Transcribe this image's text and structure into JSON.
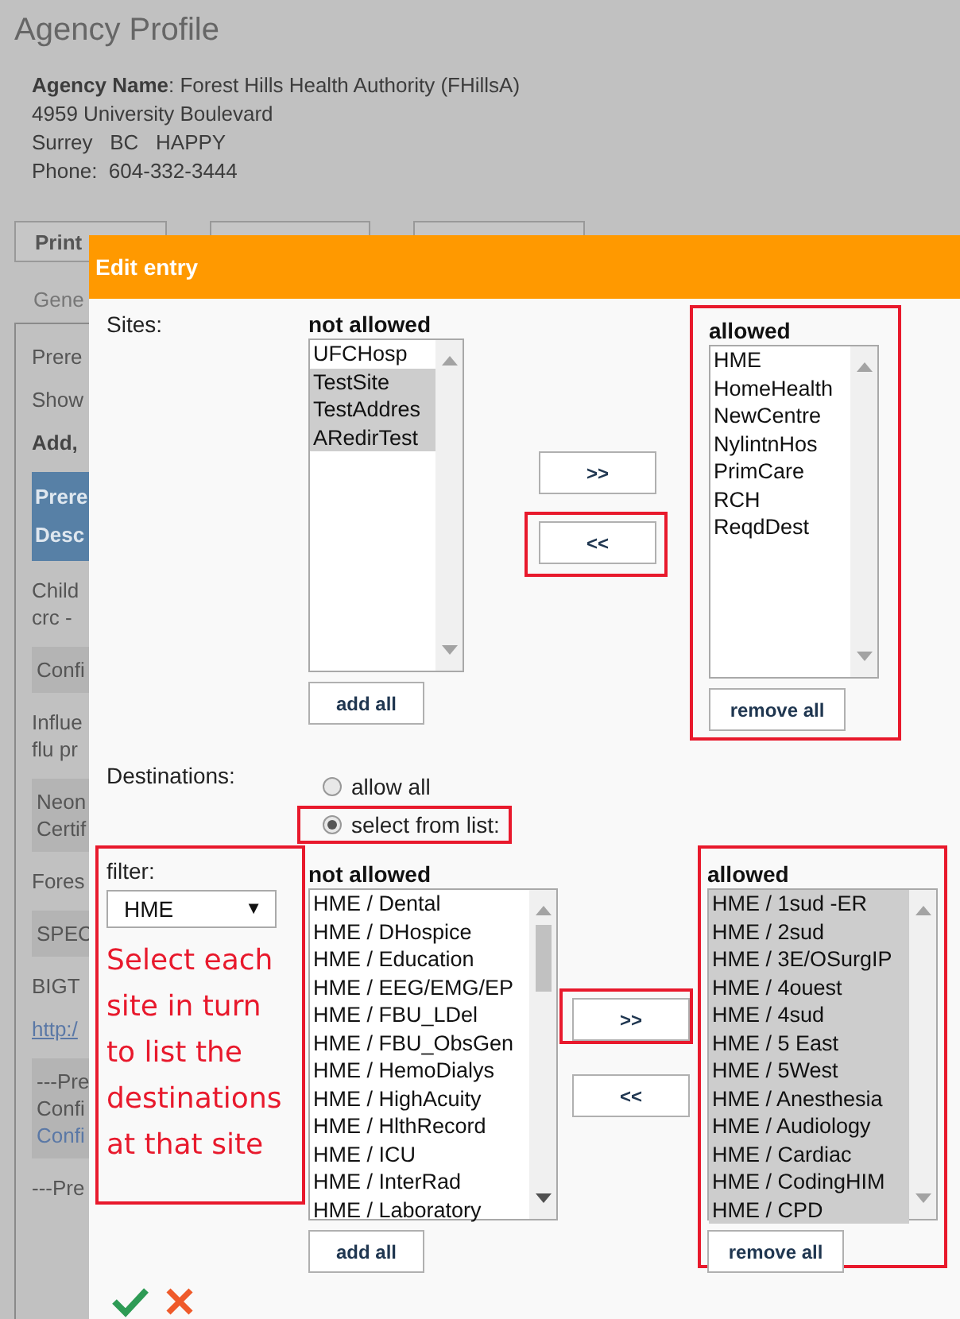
{
  "page": {
    "title": "Agency Profile",
    "info": [
      "**Agency Name**: Forest Hills Health Authority (FHillsA)",
      "4959 University Boulevard",
      "Surrey   BC   HAPPY",
      "Phone:  604-332-3444"
    ],
    "print_button": "Print",
    "tab": "Gene",
    "panel_rows": [
      {
        "kind": "text",
        "lines": [
          {
            "text": "Prere",
            "link": false
          }
        ]
      },
      {
        "kind": "text",
        "lines": [
          {
            "text": "Show",
            "link": false
          }
        ]
      },
      {
        "kind": "bold",
        "lines": [
          {
            "text": "Add,",
            "link": false
          }
        ]
      },
      {
        "kind": "header",
        "lines": [
          {
            "text": "Prere",
            "link": false
          },
          {
            "text": "Desc",
            "link": false
          }
        ]
      },
      {
        "kind": "text",
        "lines": [
          {
            "text": "Child",
            "link": false
          },
          {
            "text": "crc -",
            "link": false
          }
        ]
      },
      {
        "kind": "shaded",
        "lines": [
          {
            "text": "Confi",
            "link": false
          }
        ]
      },
      {
        "kind": "text",
        "lines": [
          {
            "text": "Influe",
            "link": false
          },
          {
            "text": "flu pr",
            "link": false
          }
        ]
      },
      {
        "kind": "shaded",
        "lines": [
          {
            "text": "Neon",
            "link": false
          },
          {
            "text": "Certif",
            "link": false
          }
        ]
      },
      {
        "kind": "text",
        "lines": [
          {
            "text": "Fores",
            "link": false
          }
        ]
      },
      {
        "kind": "shaded",
        "lines": [
          {
            "text": "SPEC",
            "link": false
          }
        ]
      },
      {
        "kind": "text",
        "lines": [
          {
            "text": "BIGT",
            "link": false
          }
        ]
      },
      {
        "kind": "text",
        "lines": [
          {
            "text": "http:/",
            "link": true
          }
        ]
      },
      {
        "kind": "shaded",
        "lines": [
          {
            "text": "---Pre",
            "link": false
          },
          {
            "text": "Confi",
            "link": false
          },
          {
            "text": "Confi",
            "link": true
          }
        ]
      },
      {
        "kind": "text",
        "lines": [
          {
            "text": "---Pre",
            "link": false
          }
        ]
      }
    ]
  },
  "dialog": {
    "title": "Edit entry",
    "sites": {
      "label": "Sites:",
      "not_allowed": {
        "heading": "not allowed",
        "highlighted": false,
        "button": "add all",
        "items": [
          {
            "text": "UFCHosp",
            "selected": false
          },
          {
            "text": "TestSite",
            "selected": true
          },
          {
            "text": "TestAddres",
            "selected": true
          },
          {
            "text": "ARedirTest",
            "selected": true
          }
        ]
      },
      "movers": [
        {
          "label": ">>",
          "highlighted": false
        },
        {
          "label": "<<",
          "highlighted": true
        }
      ],
      "allowed": {
        "heading": "allowed",
        "highlighted": true,
        "button": "remove all",
        "items": [
          {
            "text": "HME",
            "selected": false
          },
          {
            "text": "HomeHealth",
            "selected": false
          },
          {
            "text": "NewCentre",
            "selected": false
          },
          {
            "text": "NylintnHos",
            "selected": false
          },
          {
            "text": "PrimCare",
            "selected": false
          },
          {
            "text": "RCH",
            "selected": false
          },
          {
            "text": "ReqdDest",
            "selected": false
          }
        ]
      }
    },
    "destinations": {
      "label": "Destinations:",
      "options": [
        {
          "label": "allow all",
          "selected": false,
          "highlighted": false
        },
        {
          "label": "select from list:",
          "selected": true,
          "highlighted": true
        }
      ],
      "filter": {
        "label": "filter:",
        "value": "HME",
        "caret": "▼",
        "note": "Select each site in turn to list the destinations at that site",
        "highlighted": true
      },
      "not_allowed": {
        "heading": "not allowed",
        "highlighted": false,
        "button": "add all",
        "items": [
          {
            "text": "HME / Dental",
            "selected": false
          },
          {
            "text": "HME / DHospice",
            "selected": false
          },
          {
            "text": "HME / Education",
            "selected": false
          },
          {
            "text": "HME / EEG/EMG/EP",
            "selected": false
          },
          {
            "text": "HME / FBU_LDel",
            "selected": false
          },
          {
            "text": "HME / FBU_ObsGen",
            "selected": false
          },
          {
            "text": "HME / HemoDialys",
            "selected": false
          },
          {
            "text": "HME / HighAcuity",
            "selected": false
          },
          {
            "text": "HME / HlthRecord",
            "selected": false
          },
          {
            "text": "HME / ICU",
            "selected": false
          },
          {
            "text": "HME / InterRad",
            "selected": false
          },
          {
            "text": "HME / Laboratory",
            "selected": false
          }
        ]
      },
      "movers": [
        {
          "label": ">>",
          "highlighted": true
        },
        {
          "label": "<<",
          "highlighted": false
        }
      ],
      "allowed": {
        "heading": "allowed",
        "highlighted": true,
        "button": "remove all",
        "items": [
          {
            "text": "HME / 1sud -ER",
            "selected": true
          },
          {
            "text": "HME / 2sud",
            "selected": true
          },
          {
            "text": "HME / 3E/OSurgIP",
            "selected": true
          },
          {
            "text": "HME / 4ouest",
            "selected": true
          },
          {
            "text": "HME / 4sud",
            "selected": true
          },
          {
            "text": "HME / 5 East",
            "selected": true
          },
          {
            "text": "HME / 5West",
            "selected": true
          },
          {
            "text": "HME / Anesthesia",
            "selected": true
          },
          {
            "text": "HME / Audiology",
            "selected": true
          },
          {
            "text": "HME / Cardiac",
            "selected": true
          },
          {
            "text": "HME / CodingHIM",
            "selected": true
          },
          {
            "text": "HME / CPD",
            "selected": true
          }
        ]
      }
    },
    "actions": [
      {
        "kind": "confirm"
      },
      {
        "kind": "cancel"
      }
    ]
  }
}
